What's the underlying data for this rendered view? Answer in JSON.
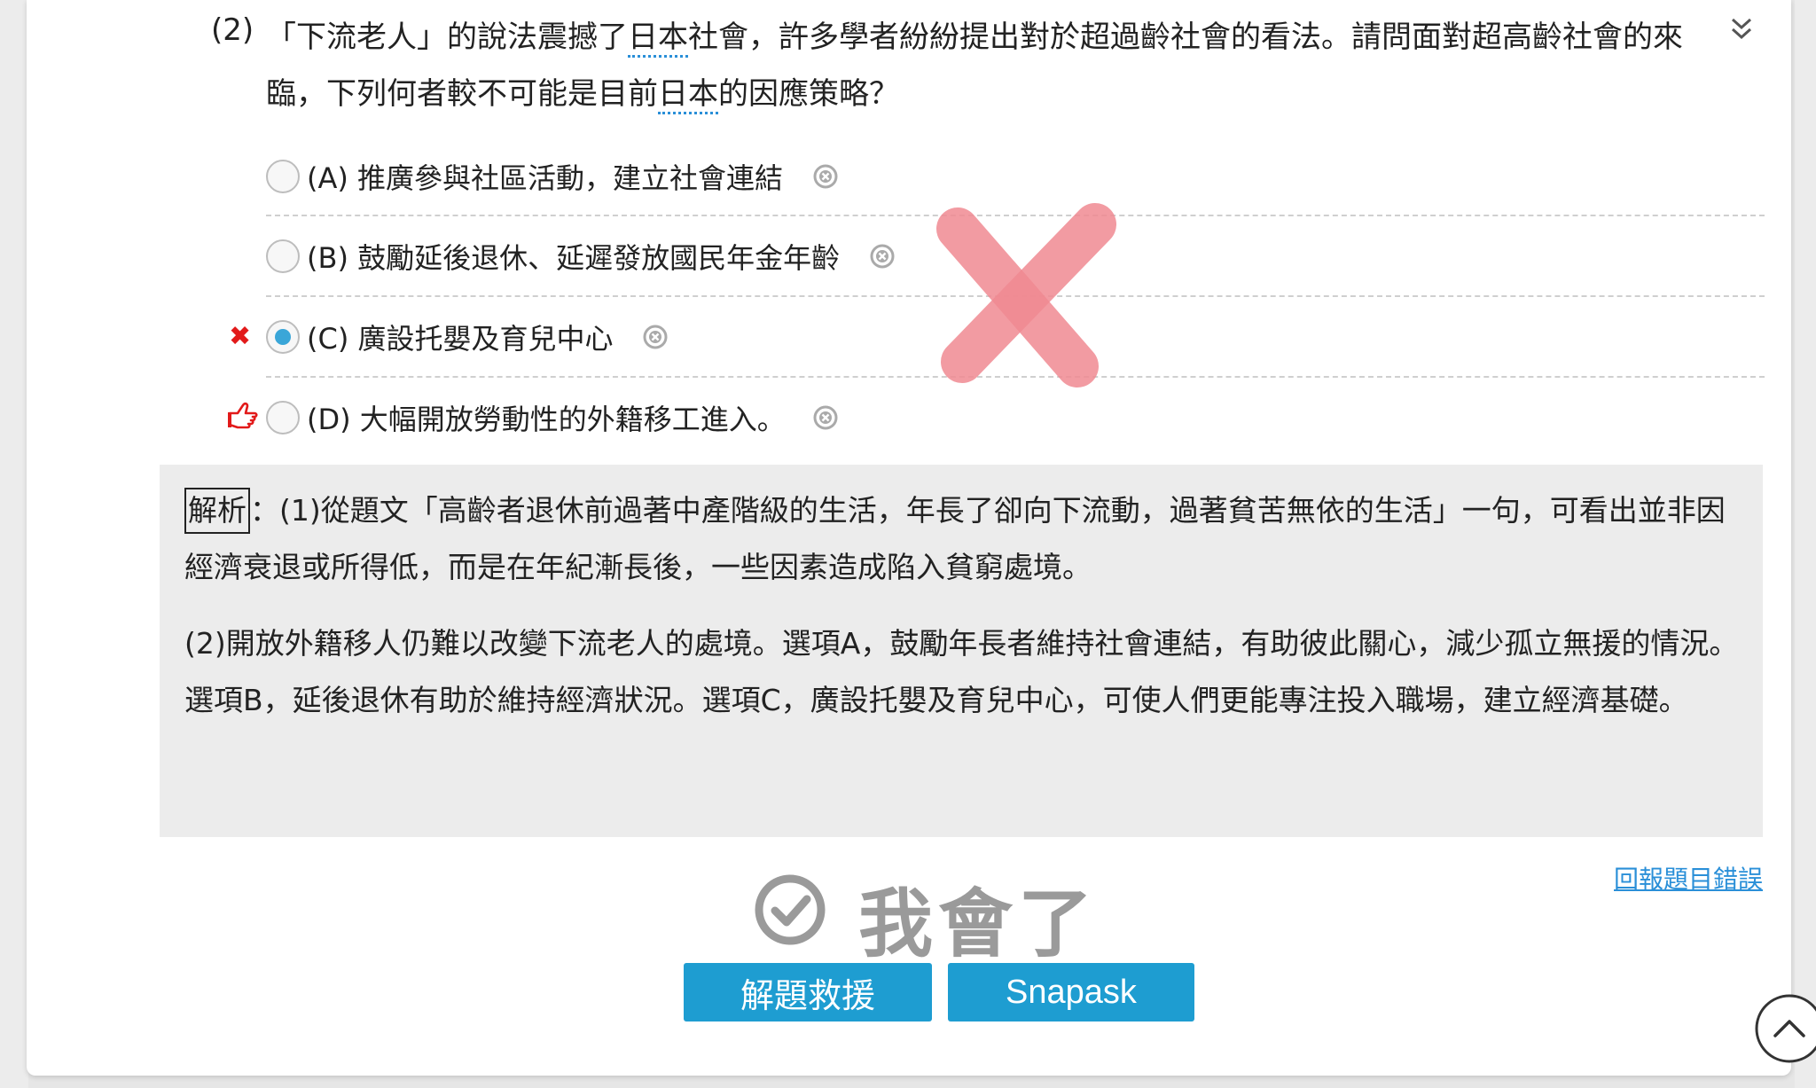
{
  "question": {
    "number": "(2)",
    "text_part1": "「下流老人」的說法震撼了",
    "term1": "日本",
    "text_part2": "社會，許多學者紛紛提出對於超過齡社會的看法。請問面對超高齡社會的來臨，下列何者較不可能是目前",
    "term2": "日本",
    "text_part3": "的因應策略？"
  },
  "options": [
    {
      "label": "(A) 推廣參與社區活動，建立社會連結",
      "selected": false
    },
    {
      "label": "(B) 鼓勵延後退休、延遲發放國民年金年齡",
      "selected": false
    },
    {
      "label": "(C) 廣設托嬰及育兒中心",
      "selected": true
    },
    {
      "label": "(D) 大幅開放勞動性的外籍移工進入。",
      "selected": false
    }
  ],
  "markers": {
    "wrong_symbol": "✖"
  },
  "analysis": {
    "tag": "解析",
    "para1": "：(1)從題文「高齡者退休前過著中產階級的生活，年長了卻向下流動，過著貧苦無依的生活」一句，可看出並非因經濟衰退或所得低，而是在年紀漸長後，一些因素造成陷入貧窮處境。",
    "para2": "(2)開放外籍移人仍難以改變下流老人的處境。選項A，鼓勵年長者維持社會連結，有助彼此關心，減少孤立無援的情況。選項B，延後退休有助於維持經濟狀況。選項C，廣設托嬰及育兒中心，可使人們更能專注投入職場，建立經濟基礎。"
  },
  "footer": {
    "report_link": "回報題目錯誤",
    "understood": "我會了",
    "help_button": "解題救援",
    "snapask_button": "Snapask"
  },
  "colors": {
    "accent": "#1e9dd1",
    "wrong": "#e21a1a",
    "big_x": "#f08a92"
  }
}
